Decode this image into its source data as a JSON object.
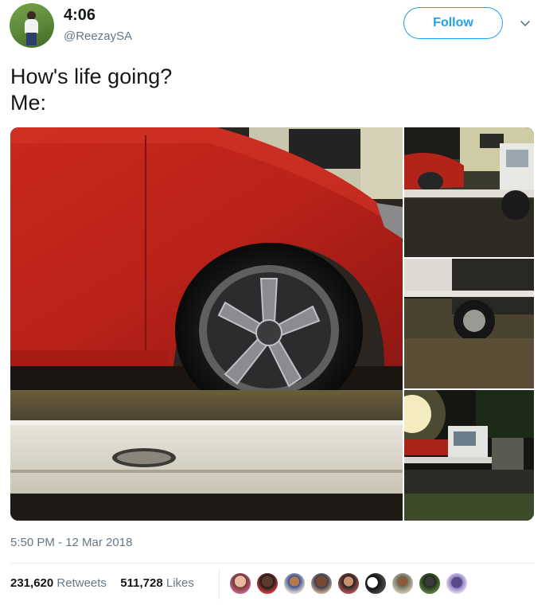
{
  "header": {
    "display_name": "4:06",
    "handle": "@ReezaySA",
    "follow_label": "Follow"
  },
  "tweet": {
    "text_line1": "How's life going?",
    "text_line2": "Me:"
  },
  "meta": {
    "timestamp": "5:50 PM - 12 Mar 2018"
  },
  "stats": {
    "retweets_count": "231,620",
    "retweets_label": "Retweets",
    "likes_count": "511,728",
    "likes_label": "Likes"
  },
  "colors": {
    "accent": "#1da1f2",
    "muted": "#657786",
    "divider": "#e6ecf0"
  },
  "icons": {
    "chevron": "chevron-down-icon"
  }
}
